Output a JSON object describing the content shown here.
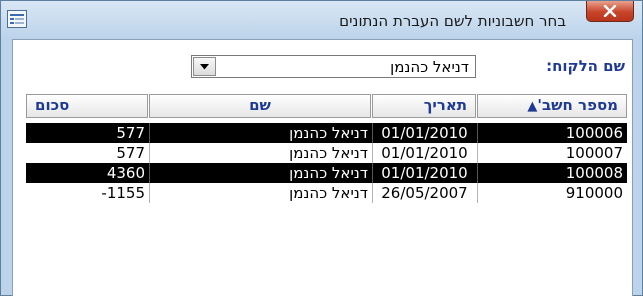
{
  "window": {
    "title": "בחר חשבוניות לשם העברת הנתונים",
    "close_icon": "close-x-icon",
    "system_icon": "form-icon"
  },
  "filter": {
    "client_label": "שם הלקוח:",
    "client_value": "דניאל כהנמן",
    "dropdown_icon": "chevron-down-icon"
  },
  "table": {
    "columns": {
      "account": "מספר חשב'",
      "date": "תאריך",
      "name": "שם",
      "sum": "סכום"
    },
    "sort_indicator": "▲",
    "rows": [
      {
        "account": "100006",
        "date": "01/01/2010",
        "name": "דניאל כהנמן",
        "sum": "577",
        "selected": true
      },
      {
        "account": "100007",
        "date": "01/01/2010",
        "name": "דניאל כהנמן",
        "sum": "577",
        "selected": false
      },
      {
        "account": "100008",
        "date": "01/01/2010",
        "name": "דניאל כהנמן",
        "sum": "4360",
        "selected": true
      },
      {
        "account": "910000",
        "date": "26/05/2007",
        "name": "דניאל כהנמן",
        "sum": "-1155",
        "selected": false
      }
    ]
  }
}
